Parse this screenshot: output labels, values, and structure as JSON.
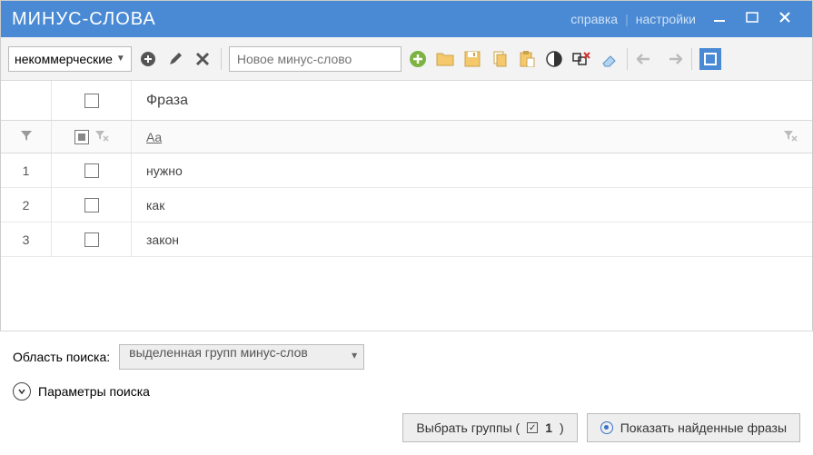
{
  "titlebar": {
    "title": "МИНУС-СЛОВА",
    "help": "справка",
    "settings": "настройки"
  },
  "toolbar": {
    "group_name": "некоммерческие",
    "new_placeholder": "Новое минус-слово"
  },
  "table": {
    "header_phrase": "Фраза",
    "filter_hint": "Aa",
    "rows": [
      {
        "n": "1",
        "phrase": "нужно"
      },
      {
        "n": "2",
        "phrase": "как"
      },
      {
        "n": "3",
        "phrase": "закон"
      }
    ]
  },
  "bottom": {
    "scope_label": "Область поиска:",
    "scope_value": "выделенная групп минус-слов",
    "params_label": "Параметры поиска",
    "select_groups_label": "Выбрать группы (",
    "select_groups_count": "1",
    "select_groups_close": ")",
    "show_found_label": "Показать найденные фразы"
  }
}
